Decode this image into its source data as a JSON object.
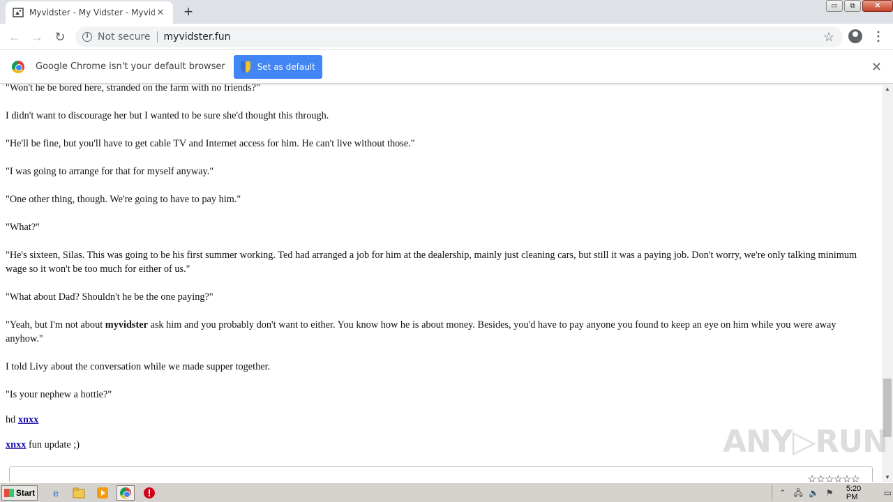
{
  "tab": {
    "title": "Myvidster - My Vidster - Myvidster.co",
    "close": "✕"
  },
  "new_tab": "+",
  "window": {
    "minimize": "▭",
    "restore": "⧉",
    "close": "✕"
  },
  "toolbar": {
    "back": "←",
    "forward": "→",
    "reload": "↻",
    "security_label": "Not secure",
    "url": "myvidster.fun",
    "bookmark": "☆",
    "menu": "⋮"
  },
  "infobar": {
    "message": "Google Chrome isn't your default browser",
    "button": "Set as default",
    "close": "✕"
  },
  "content": {
    "p1": "\"Won't he be bored here, stranded on the farm with no friends?\"",
    "p2": "I didn't want to discourage her but I wanted to be sure she'd thought this through.",
    "p3": "\"He'll be fine, but you'll have to get cable TV and Internet access for him. He can't live without those.\"",
    "p4": "\"I was going to arrange for that for myself anyway.\"",
    "p5": "\"One other thing, though. We're going to have to pay him.\"",
    "p6": "\"What?\"",
    "p7": "\"He's sixteen, Silas. This was going to be his first summer working. Ted had arranged a job for him at the dealership, mainly just cleaning cars, but still it was a paying job. Don't worry, we're only talking minimum wage so it won't be too much for either of us.\"",
    "p8": "\"What about Dad? Shouldn't he be the one paying?\"",
    "p9_before": "\"Yeah, but I'm not about ",
    "p9_bold": "myvidster",
    "p9_after": " ask him and you probably don't want to either. You know how he is about money. Besides, you'd have to pay anyone you found to keep an eye on him while you were away anyhow.\"",
    "p10": "I told Livy about the conversation while we made supper together.",
    "p11": "\"Is your nephew a hottie?\"",
    "p12_prefix": "hd ",
    "p12_link": "xnxx",
    "p13_link": "xnxx",
    "p13_suffix": " fun update ;)",
    "stars": "☆☆☆☆☆☆"
  },
  "watermark": "ANY▷RUN",
  "taskbar": {
    "start": "Start",
    "clock": "5:20 PM"
  }
}
